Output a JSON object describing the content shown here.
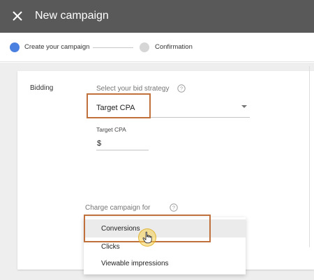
{
  "header": {
    "title": "New campaign",
    "close_icon": "close-icon"
  },
  "stepper": {
    "steps": [
      {
        "label": "Create your campaign",
        "state": "active",
        "color": "#4a80e0"
      },
      {
        "label": "Confirmation",
        "state": "inactive",
        "color": "#d6d6d6"
      }
    ]
  },
  "form": {
    "section_label": "Bidding",
    "strategy": {
      "label": "Select your bid strategy",
      "value": "Target CPA"
    },
    "target_cpa": {
      "label": "Target CPA",
      "prefix": "$"
    },
    "charge": {
      "label": "Charge campaign for",
      "options": [
        {
          "label": "Conversions",
          "selected": true
        },
        {
          "label": "Clicks",
          "selected": false
        },
        {
          "label": "Viewable impressions",
          "selected": false
        }
      ]
    }
  },
  "colors": {
    "topbar": "#595959",
    "highlight_box": "#c0703a",
    "accent": "#4a80e0"
  }
}
